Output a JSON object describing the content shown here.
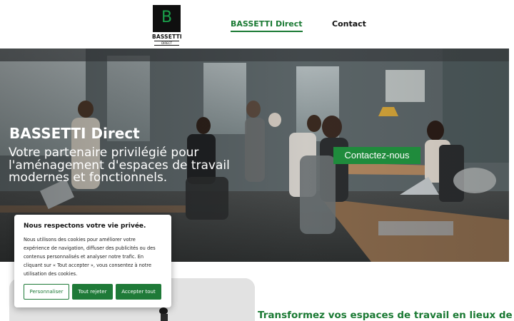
{
  "header": {
    "logo_letter": "B",
    "logo_name": "BASSETTI",
    "logo_tagline": "DIRECT",
    "nav": [
      {
        "label": "BASSETTI Direct",
        "active": true
      },
      {
        "label": "Contact",
        "active": false
      }
    ]
  },
  "hero": {
    "title": "BASSETTI Direct",
    "subtitle": "Votre partenaire privilégié pour l'aménagement d'espaces de travail modernes et fonctionnels.",
    "cta_label": "Contactez-nous"
  },
  "cookie_banner": {
    "title": "Nous respectons votre vie privée.",
    "text": "Nous utilisons des cookies pour améliorer votre expérience de navigation, diffuser des publicités ou des contenus personnalisés et analyser notre trafic. En cliquant sur « Tout accepter », vous consentez à notre utilisation des cookies.",
    "customize_label": "Personnaliser",
    "reject_label": "Tout rejeter",
    "accept_label": "Accepter tout"
  },
  "section": {
    "title": "Transformez vos espaces de travail en lieux de"
  },
  "colors": {
    "brand_green": "#1b7a34",
    "cta_green": "#1f8b3c",
    "logo_bg": "#0f0f0f"
  }
}
